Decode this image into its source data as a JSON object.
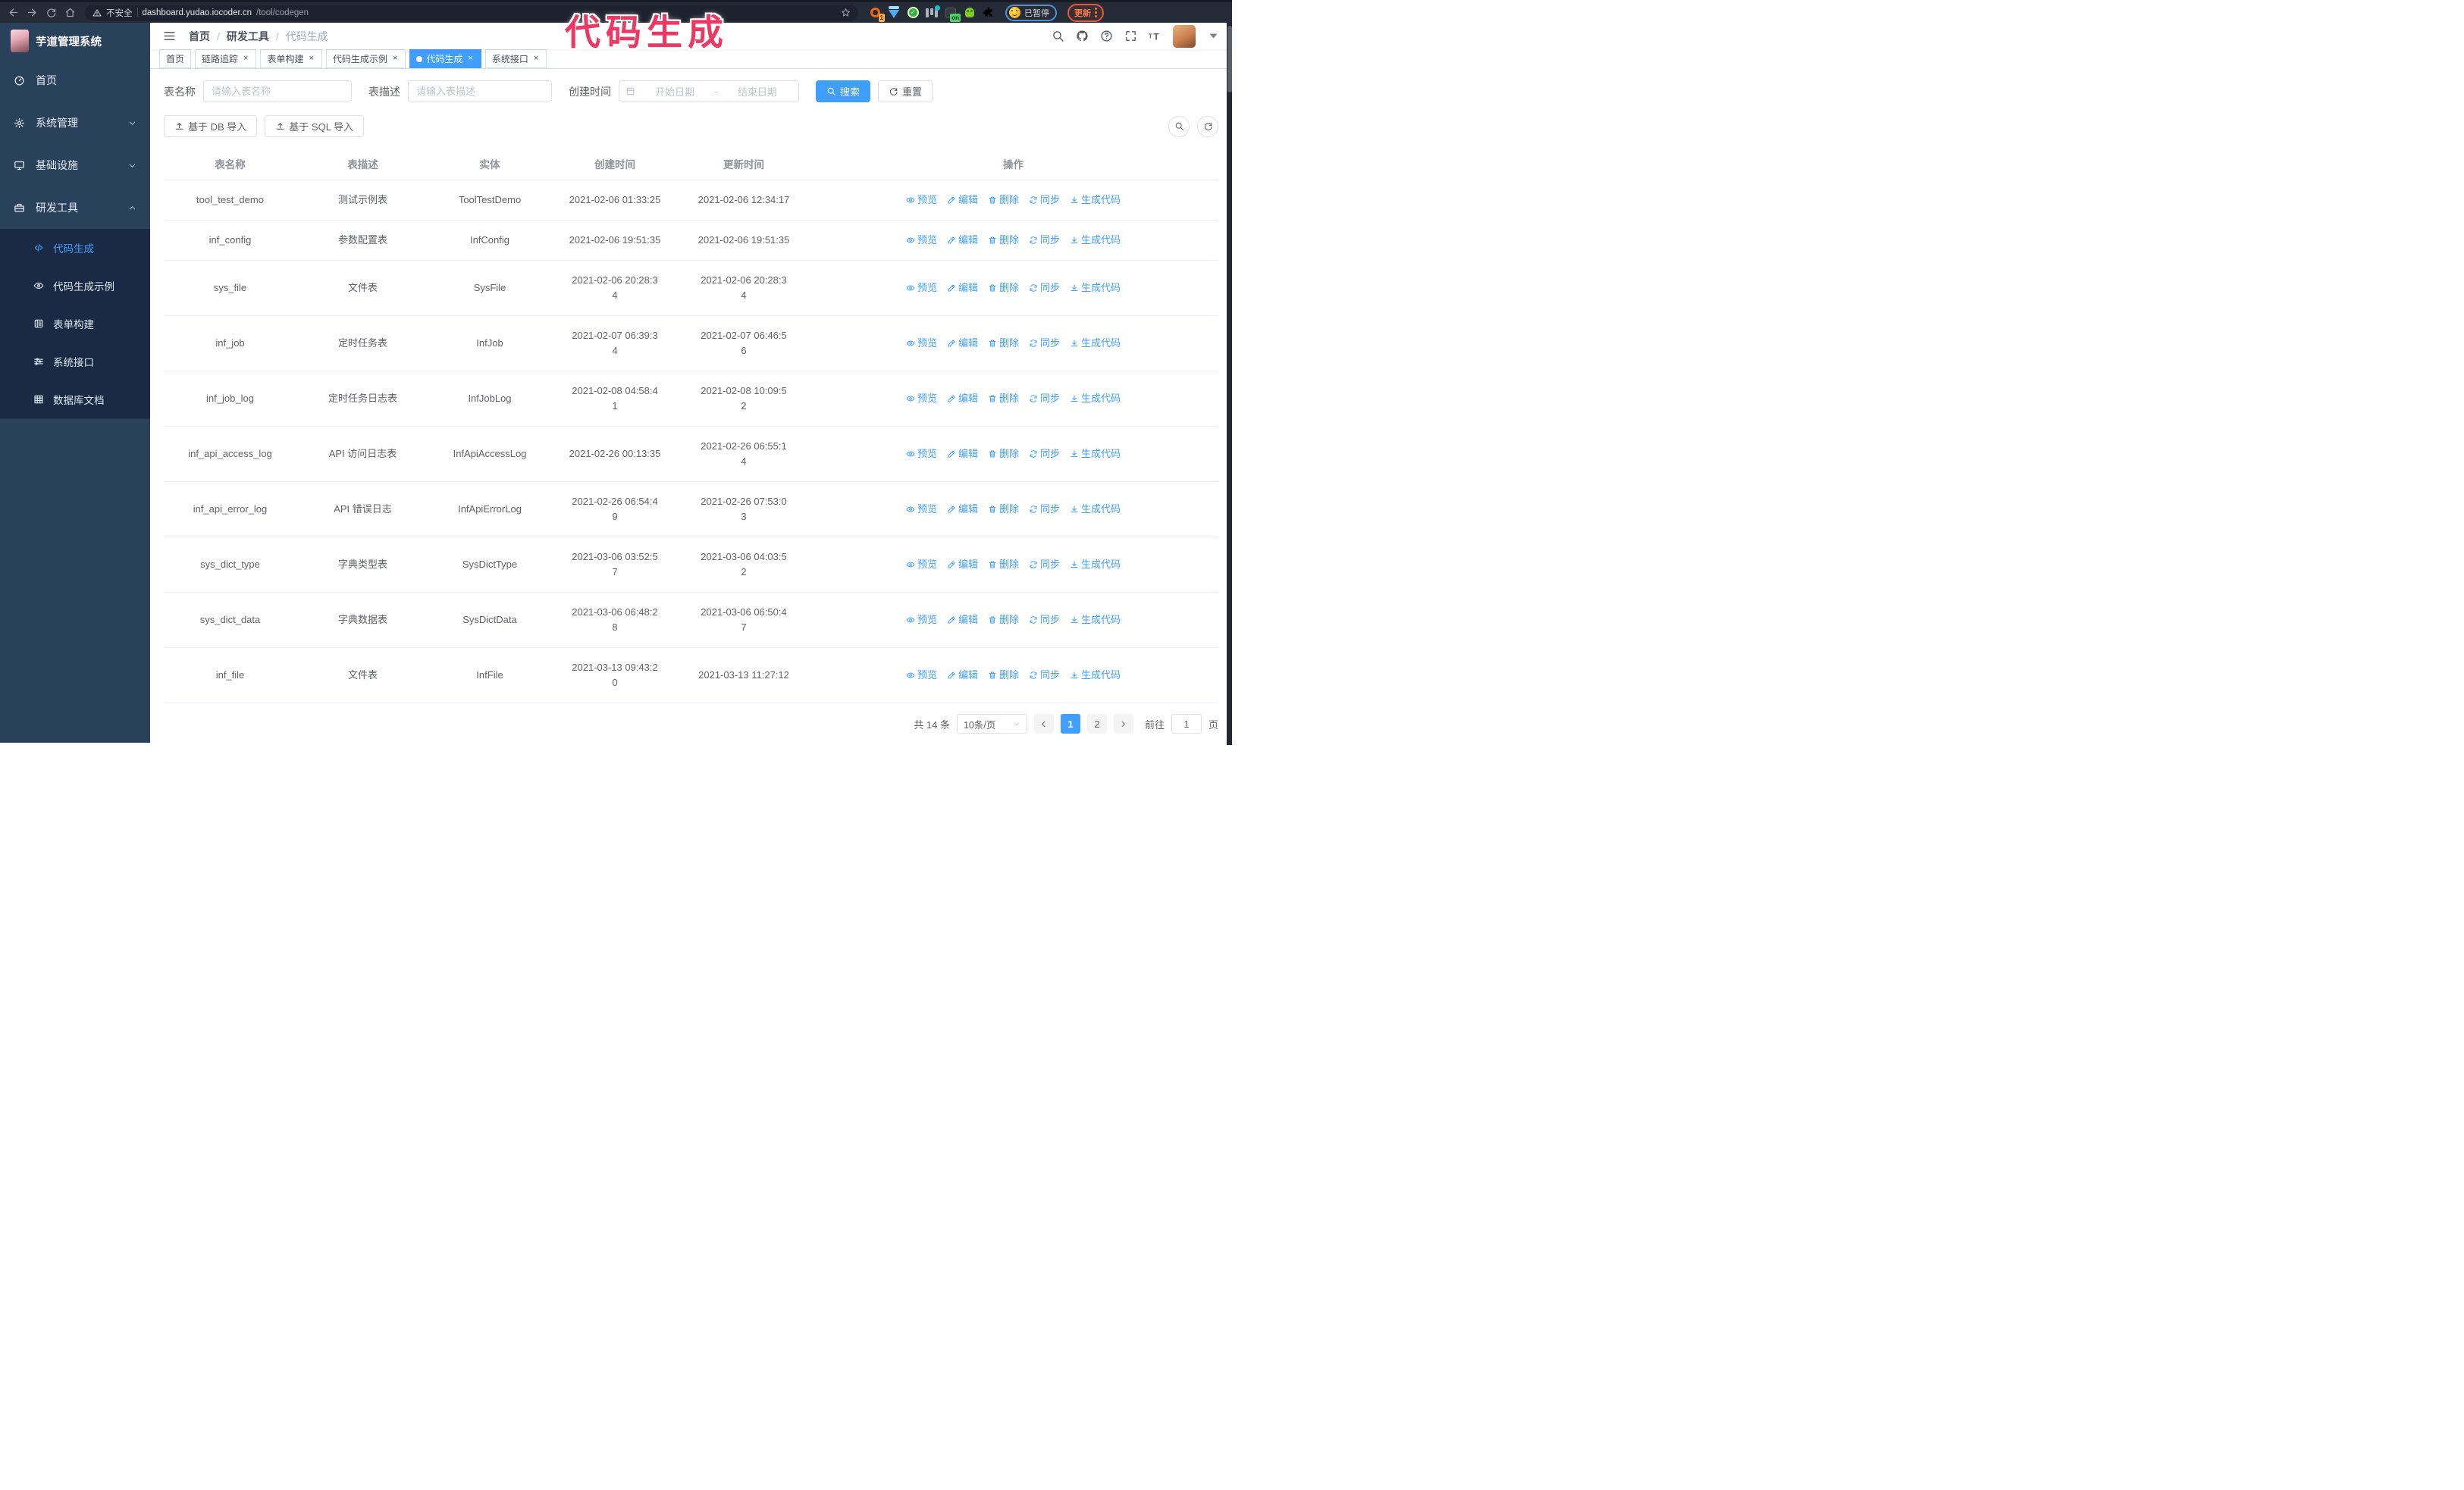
{
  "browser": {
    "security_label": "不安全",
    "url_host": "dashboard.yudao.iocoder.cn",
    "url_path": "/tool/codegen",
    "profile_label": "已暂停",
    "update_label": "更新",
    "extension_badges": {
      "orange_count": "1",
      "on_label": "on"
    }
  },
  "annotation": {
    "text": "代码生成",
    "color": "#ea3a63"
  },
  "sidebar": {
    "title": "芋道管理系统",
    "menu": [
      {
        "icon": "gauge-icon",
        "label": "首页",
        "chevron": ""
      },
      {
        "icon": "gear-icon",
        "label": "系统管理",
        "chevron": "down"
      },
      {
        "icon": "monitor-icon",
        "label": "基础设施",
        "chevron": "down"
      },
      {
        "icon": "toolbox-icon",
        "label": "研发工具",
        "chevron": "up"
      }
    ],
    "submenu": [
      {
        "icon": "code-icon",
        "label": "代码生成",
        "active": true
      },
      {
        "icon": "eye-badge-icon",
        "label": "代码生成示例",
        "active": false
      },
      {
        "icon": "form-icon",
        "label": "表单构建",
        "active": false
      },
      {
        "icon": "sliders-icon",
        "label": "系统接口",
        "active": false
      },
      {
        "icon": "grid-icon",
        "label": "数据库文档",
        "active": false
      }
    ]
  },
  "header": {
    "breadcrumb": [
      "首页",
      "研发工具",
      "代码生成"
    ],
    "breadcrumb_separator": "/"
  },
  "tabs": {
    "close_glyph": "×",
    "items": [
      {
        "label": "首页",
        "closable": false,
        "active": false
      },
      {
        "label": "链路追踪",
        "closable": true,
        "active": false
      },
      {
        "label": "表单构建",
        "closable": true,
        "active": false
      },
      {
        "label": "代码生成示例",
        "closable": true,
        "active": false
      },
      {
        "label": "代码生成",
        "closable": true,
        "active": true
      },
      {
        "label": "系统接口",
        "closable": true,
        "active": false
      }
    ]
  },
  "filters": {
    "name_label": "表名称",
    "name_placeholder": "请输入表名称",
    "desc_label": "表描述",
    "desc_placeholder": "请输入表描述",
    "date_label": "创建时间",
    "date_start_placeholder": "开始日期",
    "date_separator": "-",
    "date_end_placeholder": "结束日期",
    "search_label": "搜索",
    "reset_label": "重置"
  },
  "toolbar": {
    "import_db_label": "基于 DB 导入",
    "import_sql_label": "基于 SQL 导入"
  },
  "table": {
    "columns": [
      "表名称",
      "表描述",
      "实体",
      "创建时间",
      "更新时间",
      "操作"
    ],
    "row_actions": [
      {
        "icon": "eye-icon",
        "label": "预览"
      },
      {
        "icon": "edit-icon",
        "label": "编辑"
      },
      {
        "icon": "trash-icon",
        "label": "删除"
      },
      {
        "icon": "sync-icon",
        "label": "同步"
      },
      {
        "icon": "download-icon",
        "label": "生成代码"
      }
    ],
    "rows": [
      {
        "name": "tool_test_demo",
        "desc": "测试示例表",
        "entity": "ToolTestDemo",
        "create_time": "2021-02-06 01:33:25",
        "update_time": "2021-02-06 12:34:17"
      },
      {
        "name": "inf_config",
        "desc": "参数配置表",
        "entity": "InfConfig",
        "create_time": "2021-02-06 19:51:35",
        "update_time": "2021-02-06 19:51:35"
      },
      {
        "name": "sys_file",
        "desc": "文件表",
        "entity": "SysFile",
        "create_time": "2021-02-06 20:28:3\n4",
        "update_time": "2021-02-06 20:28:3\n4"
      },
      {
        "name": "inf_job",
        "desc": "定时任务表",
        "entity": "InfJob",
        "create_time": "2021-02-07 06:39:3\n4",
        "update_time": "2021-02-07 06:46:5\n6"
      },
      {
        "name": "inf_job_log",
        "desc": "定时任务日志表",
        "entity": "InfJobLog",
        "create_time": "2021-02-08 04:58:4\n1",
        "update_time": "2021-02-08 10:09:5\n2"
      },
      {
        "name": "inf_api_access_log",
        "desc": "API 访问日志表",
        "entity": "InfApiAccessLog",
        "create_time": "2021-02-26 00:13:35",
        "update_time": "2021-02-26 06:55:1\n4"
      },
      {
        "name": "inf_api_error_log",
        "desc": "API 错误日志",
        "entity": "InfApiErrorLog",
        "create_time": "2021-02-26 06:54:4\n9",
        "update_time": "2021-02-26 07:53:0\n3"
      },
      {
        "name": "sys_dict_type",
        "desc": "字典类型表",
        "entity": "SysDictType",
        "create_time": "2021-03-06 03:52:5\n7",
        "update_time": "2021-03-06 04:03:5\n2"
      },
      {
        "name": "sys_dict_data",
        "desc": "字典数据表",
        "entity": "SysDictData",
        "create_time": "2021-03-06 06:48:2\n8",
        "update_time": "2021-03-06 06:50:4\n7"
      },
      {
        "name": "inf_file",
        "desc": "文件表",
        "entity": "InfFile",
        "create_time": "2021-03-13 09:43:2\n0",
        "update_time": "2021-03-13 11:27:12"
      }
    ]
  },
  "pagination": {
    "total_label": "共 14 条",
    "page_size_label": "10条/页",
    "pages": [
      {
        "label": "1",
        "active": true
      },
      {
        "label": "2",
        "active": false
      }
    ],
    "goto_prefix": "前往",
    "goto_value": "1",
    "goto_suffix": "页"
  },
  "colors": {
    "accent": "#409eff",
    "sidebar_bg": "#2a415c",
    "submenu_bg": "#1b2a44",
    "annotation": "#ea3a63"
  }
}
